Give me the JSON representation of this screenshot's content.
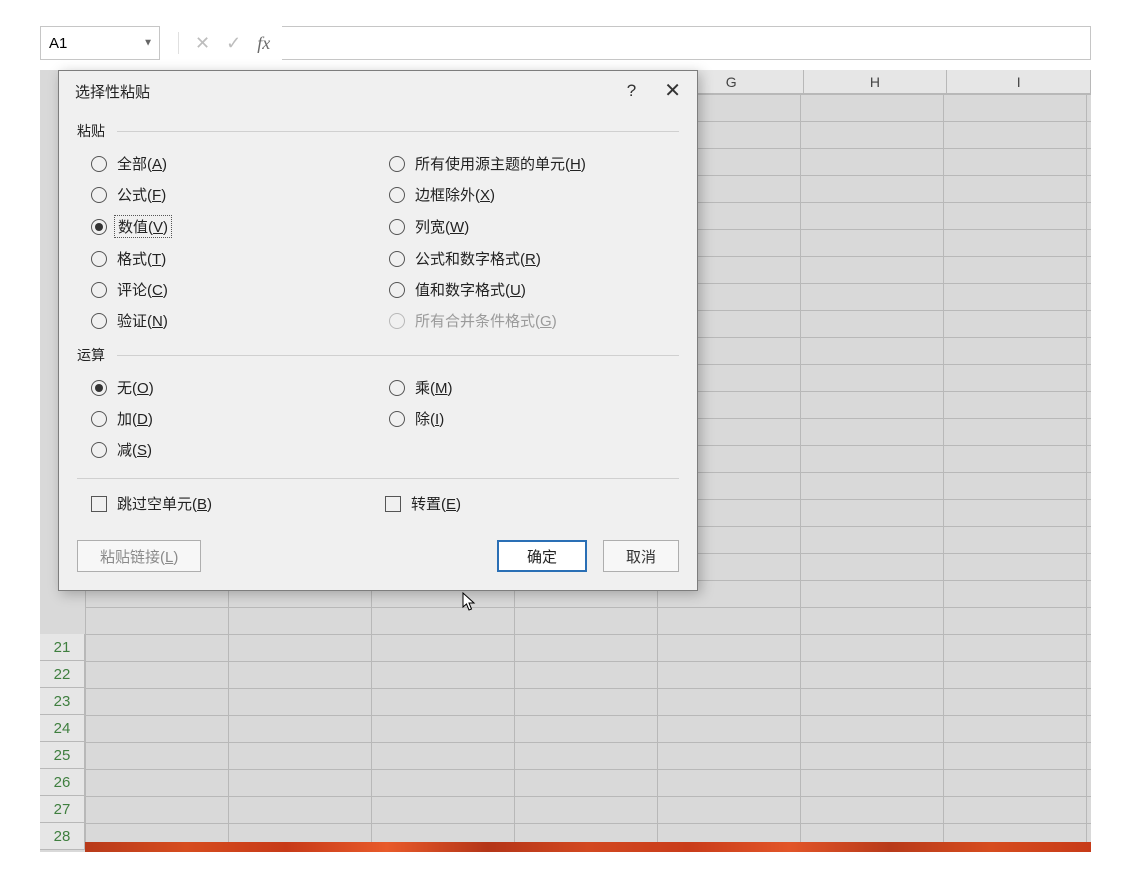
{
  "formula_bar": {
    "name_box": "A1",
    "fx_label": "fx"
  },
  "columns": [
    "G",
    "H",
    "I"
  ],
  "rows": [
    21,
    22,
    23,
    24,
    25,
    26,
    27,
    28
  ],
  "dialog": {
    "title": "选择性粘贴",
    "help": "?",
    "close": "✕",
    "group_paste": "粘贴",
    "group_operation": "运算",
    "paste_options_left": [
      {
        "label": "全部",
        "accel": "A",
        "selected": false
      },
      {
        "label": "公式",
        "accel": "F",
        "selected": false
      },
      {
        "label": "数值",
        "accel": "V",
        "selected": true,
        "focus": true
      },
      {
        "label": "格式",
        "accel": "T",
        "selected": false
      },
      {
        "label": "评论",
        "accel": "C",
        "selected": false
      },
      {
        "label": "验证",
        "accel": "N",
        "selected": false
      }
    ],
    "paste_options_right": [
      {
        "label": "所有使用源主题的单元",
        "accel": "H",
        "selected": false
      },
      {
        "label": "边框除外",
        "accel": "X",
        "selected": false
      },
      {
        "label": "列宽",
        "accel": "W",
        "selected": false
      },
      {
        "label": "公式和数字格式",
        "accel": "R",
        "selected": false
      },
      {
        "label": "值和数字格式",
        "accel": "U",
        "selected": false
      },
      {
        "label": "所有合并条件格式",
        "accel": "G",
        "selected": false,
        "disabled": true
      }
    ],
    "op_options_left": [
      {
        "label": "无",
        "accel": "O",
        "selected": true
      },
      {
        "label": "加",
        "accel": "D",
        "selected": false
      },
      {
        "label": "减",
        "accel": "S",
        "selected": false
      }
    ],
    "op_options_right": [
      {
        "label": "乘",
        "accel": "M",
        "selected": false
      },
      {
        "label": "除",
        "accel": "I",
        "selected": false
      }
    ],
    "skip_blanks": {
      "label": "跳过空单元",
      "accel": "B",
      "checked": false
    },
    "transpose": {
      "label": "转置",
      "accel": "E",
      "checked": false
    },
    "paste_link": {
      "label": "粘贴链接",
      "accel": "L"
    },
    "ok": "确定",
    "cancel": "取消"
  }
}
